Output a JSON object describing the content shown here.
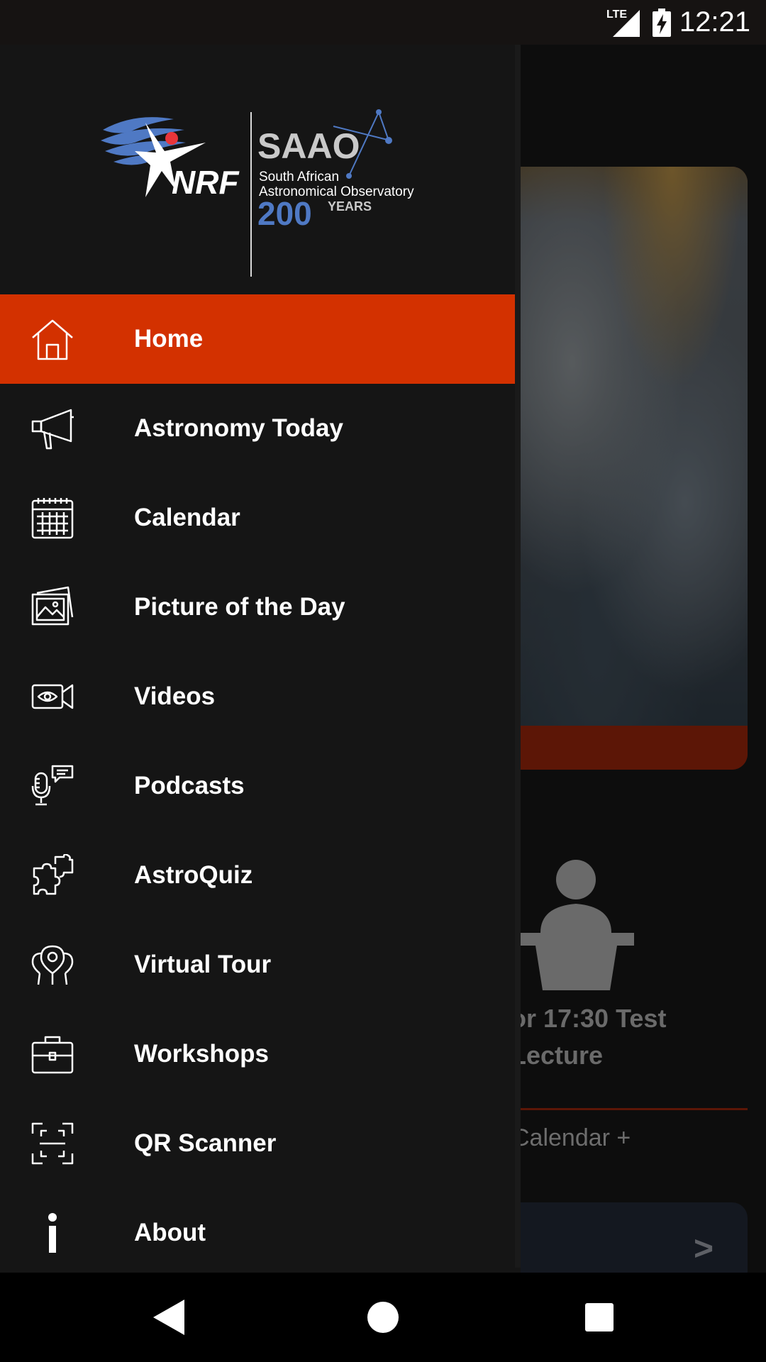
{
  "status_bar": {
    "time": "12:21",
    "network": "LTE"
  },
  "drawer": {
    "logo": {
      "nrf": "NRF",
      "saao": "SAAO",
      "line1": "South African",
      "line2": "Astronomical Observatory",
      "years_number": "200",
      "years_label": "YEARS"
    },
    "items": [
      {
        "label": "Home",
        "icon": "home-icon",
        "active": true
      },
      {
        "label": "Astronomy Today",
        "icon": "megaphone-icon",
        "active": false
      },
      {
        "label": "Calendar",
        "icon": "calendar-icon",
        "active": false
      },
      {
        "label": "Picture of the Day",
        "icon": "picture-icon",
        "active": false
      },
      {
        "label": "Videos",
        "icon": "video-camera-icon",
        "active": false
      },
      {
        "label": "Podcasts",
        "icon": "microphone-icon",
        "active": false
      },
      {
        "label": "AstroQuiz",
        "icon": "puzzle-icon",
        "active": false
      },
      {
        "label": "Virtual Tour",
        "icon": "location-pins-icon",
        "active": false
      },
      {
        "label": "Workshops",
        "icon": "briefcase-icon",
        "active": false
      },
      {
        "label": "QR Scanner",
        "icon": "qr-scan-icon",
        "active": false
      },
      {
        "label": "About",
        "icon": "info-icon",
        "active": false
      }
    ]
  },
  "background": {
    "lecture_title": "or 17:30 Test Lecture",
    "calendar_link": "Calendar +",
    "card_arrow": ">"
  },
  "colors": {
    "accent": "#d33100",
    "drawer_bg": "#151515",
    "logo_blue": "#4f79c4"
  }
}
